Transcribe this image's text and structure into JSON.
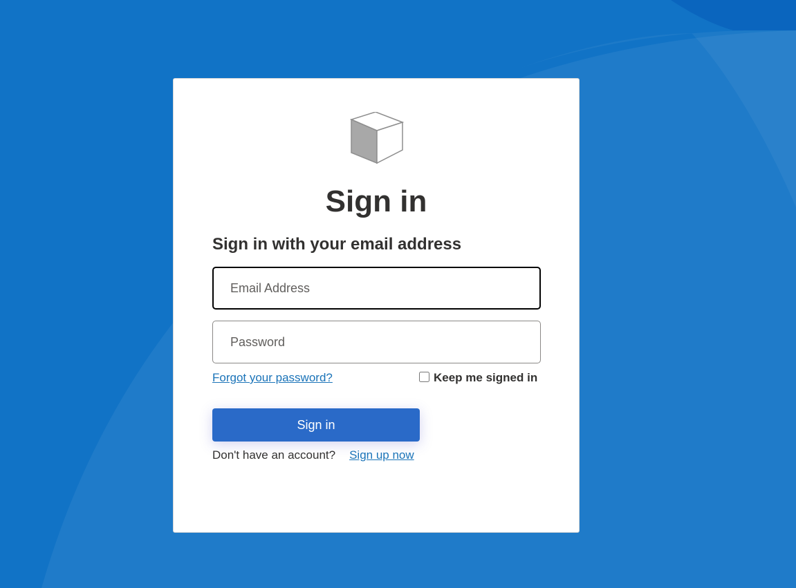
{
  "page": {
    "title": "Sign in",
    "subtitle": "Sign in with your email address"
  },
  "logo": {
    "icon": "cube-icon"
  },
  "form": {
    "email_placeholder": "Email Address",
    "email_value": "",
    "password_placeholder": "Password",
    "password_value": "",
    "forgot_link": "Forgot your password?",
    "keep_signed_in_label": "Keep me signed in",
    "keep_signed_in_checked": false,
    "submit_label": "Sign in"
  },
  "signup": {
    "prompt": "Don't have an account?",
    "link": "Sign up now"
  },
  "colors": {
    "background": "#1173c6",
    "primary_button": "#2a6ac8",
    "link": "#1a73b8",
    "text": "#323130"
  }
}
